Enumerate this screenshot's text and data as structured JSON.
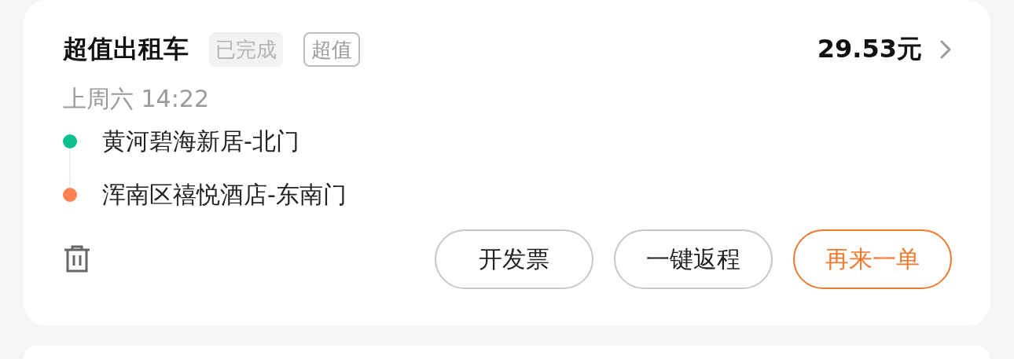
{
  "order": {
    "title": "超值出租车",
    "tags": [
      {
        "label": "已完成",
        "kind": "filled"
      },
      {
        "label": "超值",
        "kind": "outline"
      }
    ],
    "price": "29.53元",
    "time": "上周六 14:22",
    "stops": [
      {
        "name": "黄河碧海新居-北门",
        "color": "#0dbf8c"
      },
      {
        "name": "浑南区禧悦酒店-东南门",
        "color": "#ff8350"
      }
    ],
    "buttons": [
      {
        "label": "开发票",
        "kind": "default"
      },
      {
        "label": "一键返程",
        "kind": "default"
      },
      {
        "label": "再来一单",
        "kind": "primary"
      }
    ]
  }
}
